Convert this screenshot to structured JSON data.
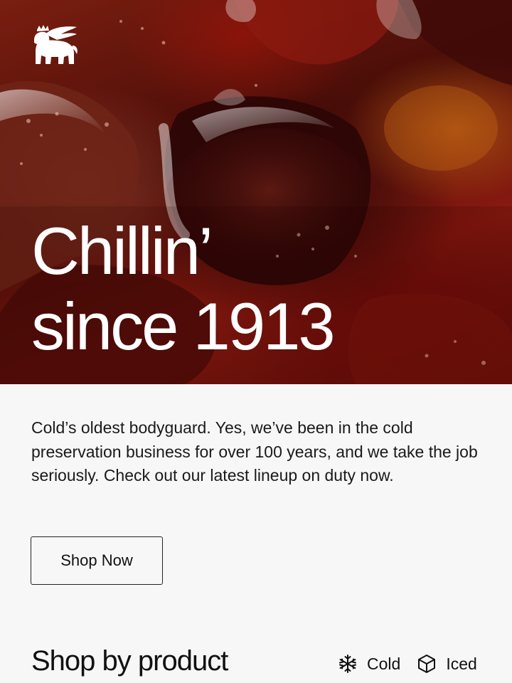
{
  "hero": {
    "headline_line1": "Chillin’",
    "headline_line2": "since 1913"
  },
  "intro": {
    "text": "Cold’s oldest bodyguard. Yes, we’ve been in the cold preservation business for over 100 years, and we take the job seriously. Check out our latest lineup on duty now."
  },
  "cta": {
    "label": "Shop Now"
  },
  "shop_by_product": {
    "title": "Shop by product",
    "filters": [
      {
        "label": "Cold",
        "icon": "snowflake-icon"
      },
      {
        "label": "Iced",
        "icon": "ice-cube-icon"
      }
    ]
  },
  "colors": {
    "page_background": "#f7f7f7",
    "text": "#111111",
    "hero_text": "#ffffff",
    "button_border": "#222222"
  }
}
